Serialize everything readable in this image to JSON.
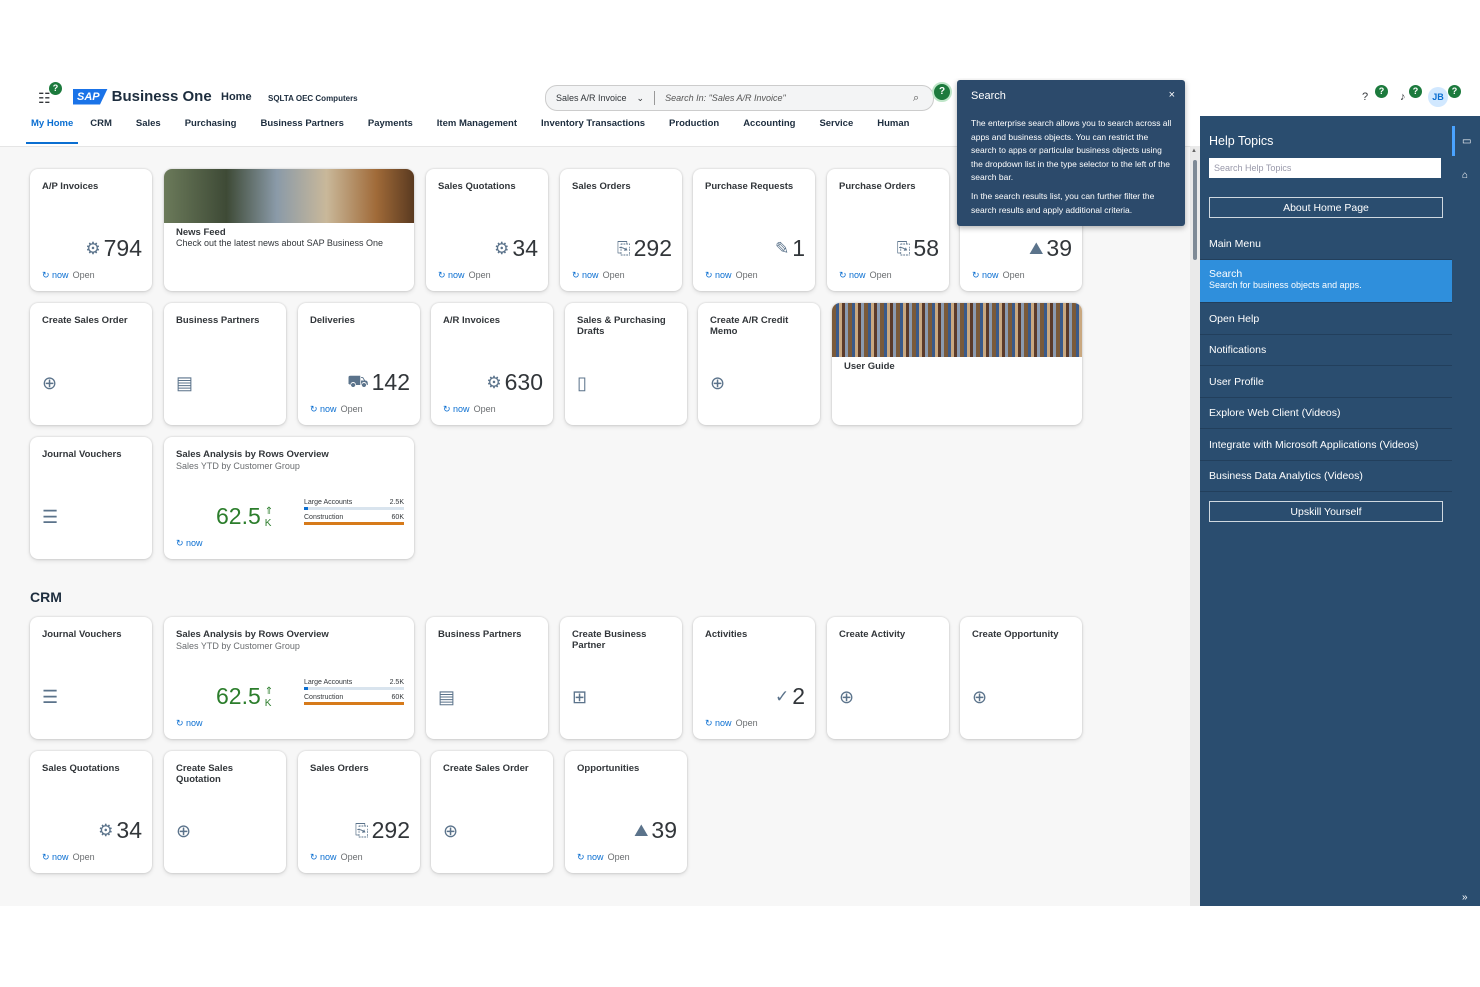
{
  "header": {
    "logo_sap": "SAP",
    "logo_text": "Business One",
    "home": "Home",
    "company": "SQLTA OEC Computers",
    "search_scope": "Sales A/R Invoice",
    "search_placeholder": "Search In: \"Sales A/R Invoice\"",
    "badge": "?"
  },
  "nav": [
    "My Home",
    "CRM",
    "Sales",
    "Purchasing",
    "Business Partners",
    "Payments",
    "Item Management",
    "Inventory Transactions",
    "Production",
    "Accounting",
    "Service",
    "Human"
  ],
  "common": {
    "now": "now",
    "open": "Open"
  },
  "home_tiles": {
    "ap_invoices": {
      "title": "A/P Invoices",
      "value": "794"
    },
    "news": {
      "title": "News Feed",
      "sub": "Check out the latest news about SAP Business One"
    },
    "sales_quotations": {
      "title": "Sales Quotations",
      "value": "34"
    },
    "sales_orders": {
      "title": "Sales Orders",
      "value": "292"
    },
    "purchase_requests": {
      "title": "Purchase Requests",
      "value": "1"
    },
    "purchase_orders": {
      "title": "Purchase Orders",
      "value": "58"
    },
    "hidden_tile": {
      "value": "39"
    },
    "create_sales_order": {
      "title": "Create Sales Order"
    },
    "business_partners": {
      "title": "Business Partners"
    },
    "deliveries": {
      "title": "Deliveries",
      "value": "142"
    },
    "ar_invoices": {
      "title": "A/R Invoices",
      "value": "630"
    },
    "drafts": {
      "title": "Sales & Purchasing Drafts"
    },
    "credit_memo": {
      "title": "Create A/R Credit Memo"
    },
    "user_guide": {
      "title": "User Guide"
    },
    "journal_vouchers": {
      "title": "Journal Vouchers"
    },
    "sales_analysis": {
      "title": "Sales Analysis by Rows Overview",
      "sub": "Sales YTD by Customer Group",
      "value": "62.5",
      "unit": "K",
      "bar1_label": "Large Accounts",
      "bar1_value": "2.5K",
      "bar2_label": "Construction",
      "bar2_value": "60K"
    }
  },
  "crm": {
    "section": "CRM",
    "journal_vouchers": {
      "title": "Journal Vouchers"
    },
    "sales_analysis": {
      "title": "Sales Analysis by Rows Overview",
      "sub": "Sales YTD by Customer Group",
      "value": "62.5",
      "unit": "K",
      "bar1_label": "Large Accounts",
      "bar1_value": "2.5K",
      "bar2_label": "Construction",
      "bar2_value": "60K"
    },
    "business_partners": {
      "title": "Business Partners"
    },
    "create_bp": {
      "title": "Create Business Partner"
    },
    "activities": {
      "title": "Activities",
      "value": "2"
    },
    "create_activity": {
      "title": "Create Activity"
    },
    "create_opportunity": {
      "title": "Create Opportunity"
    },
    "sales_quotations": {
      "title": "Sales Quotations",
      "value": "34"
    },
    "create_sq": {
      "title": "Create Sales Quotation"
    },
    "sales_orders": {
      "title": "Sales Orders",
      "value": "292"
    },
    "create_so": {
      "title": "Create Sales Order"
    },
    "opportunities": {
      "title": "Opportunities",
      "value": "39"
    }
  },
  "tooltip": {
    "title": "Search",
    "close": "×",
    "p1": "The enterprise search allows you to search across all apps and business objects. You can restrict the search to apps or particular business objects using the dropdown list in the type selector to the left of the search bar.",
    "p2": "In the search results list, you can further filter the search results and apply additional criteria."
  },
  "user": {
    "initials": "JB"
  },
  "help": {
    "title": "Help Topics",
    "search_placeholder": "Search Help Topics",
    "about": "About Home Page",
    "main_menu": "Main Menu",
    "search_title": "Search",
    "search_sub": "Search for business objects and apps.",
    "open_help": "Open Help",
    "notifications": "Notifications",
    "user_profile": "User Profile",
    "explore": "Explore Web Client (Videos)",
    "integrate": "Integrate with Microsoft Applications (Videos)",
    "analytics": "Business Data Analytics (Videos)",
    "upskill": "Upskill Yourself"
  },
  "colors": {
    "accent": "#0a6ed1",
    "panel": "#2a4d6f",
    "selected": "#2f8fdc",
    "kpi_green": "#2b7d2b",
    "bar_orange": "#d67a1a",
    "bar_blue": "#0a6ed1"
  }
}
